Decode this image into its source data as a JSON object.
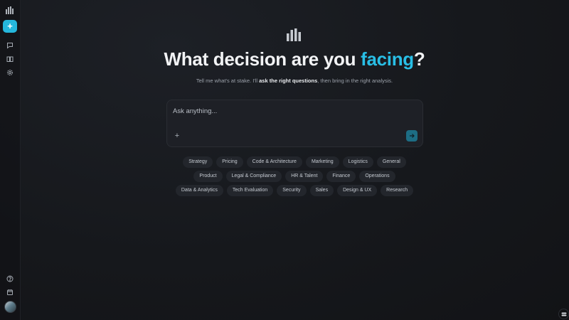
{
  "sidebar": {
    "logo_icon": "bars-logo-icon",
    "new_icon": "plus-icon",
    "nav": [
      {
        "icon": "chat-bubble-icon"
      },
      {
        "icon": "book-icon"
      },
      {
        "icon": "gear-icon"
      }
    ],
    "bottom": [
      {
        "icon": "help-circle-icon"
      },
      {
        "icon": "calendar-icon"
      },
      {
        "icon": "avatar"
      }
    ],
    "accent_color": "#25b7dc"
  },
  "hero": {
    "title_prefix": "What decision are you ",
    "title_accent": "facing",
    "title_suffix": "?",
    "subtitle_prefix": "Tell me what's at stake. I'll ",
    "subtitle_bold": "ask the right questions",
    "subtitle_suffix": ", then bring in the right analysis.",
    "accent_color": "#29bfe6"
  },
  "composer": {
    "placeholder": "Ask anything...",
    "value": "",
    "attach_label": "+",
    "send_icon": "arrow-right-icon"
  },
  "chips": {
    "row1": [
      "Strategy",
      "Pricing",
      "Code & Architecture",
      "Marketing",
      "Logistics",
      "General"
    ],
    "row2": [
      "Product",
      "Legal & Compliance",
      "HR & Talent",
      "Finance",
      "Operations"
    ],
    "row3": [
      "Data & Analytics",
      "Tech Evaluation",
      "Security",
      "Sales",
      "Design & UX",
      "Research"
    ]
  }
}
